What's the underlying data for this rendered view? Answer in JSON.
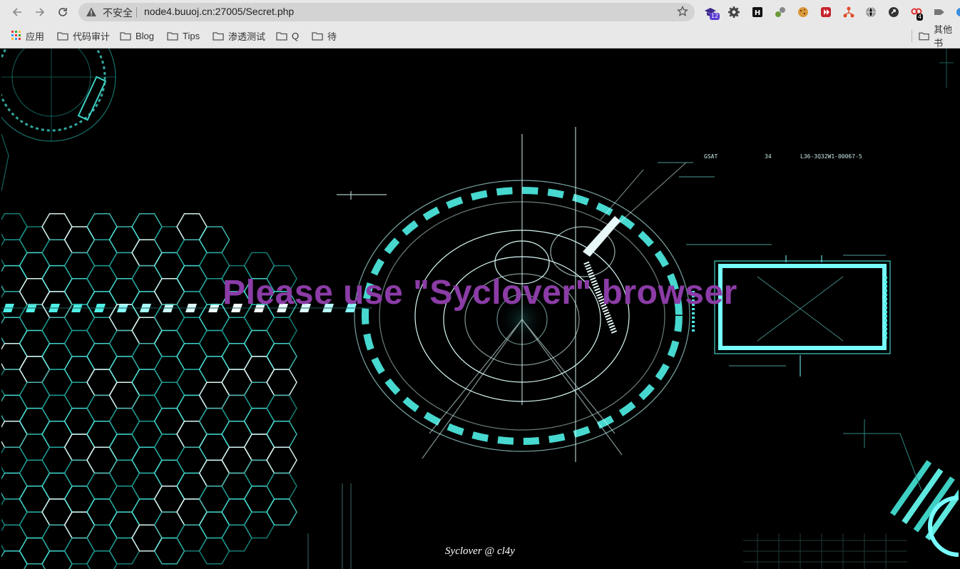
{
  "browser": {
    "address_bar": {
      "security_label": "不安全",
      "url": "node4.buuoj.cn:27005/Secret.php"
    },
    "extensions": {
      "first_badge": "12",
      "red_badge": "4"
    },
    "bookmarks": [
      {
        "label": "应用",
        "icon": "apps-grid-icon"
      },
      {
        "label": "代码审计",
        "icon": "folder-icon"
      },
      {
        "label": "Blog",
        "icon": "folder-icon"
      },
      {
        "label": "Tips",
        "icon": "folder-icon"
      },
      {
        "label": "渗透测试",
        "icon": "folder-icon"
      },
      {
        "label": "Q",
        "icon": "folder-icon"
      },
      {
        "label": "待",
        "icon": "folder-icon"
      }
    ],
    "other_bookmarks_label": "其他书"
  },
  "page": {
    "headline": "Please use \"Syclover\" browser",
    "footer": "Syclover @ cl4y",
    "hud_labels": {
      "gsat": "GSAT",
      "gsat_num": "34",
      "code": "L36-3Q32W1-00067-5"
    }
  },
  "colors": {
    "headline": "#8b3ca6",
    "cyan_accent": "#4ff0e6",
    "page_background": "#000000"
  }
}
